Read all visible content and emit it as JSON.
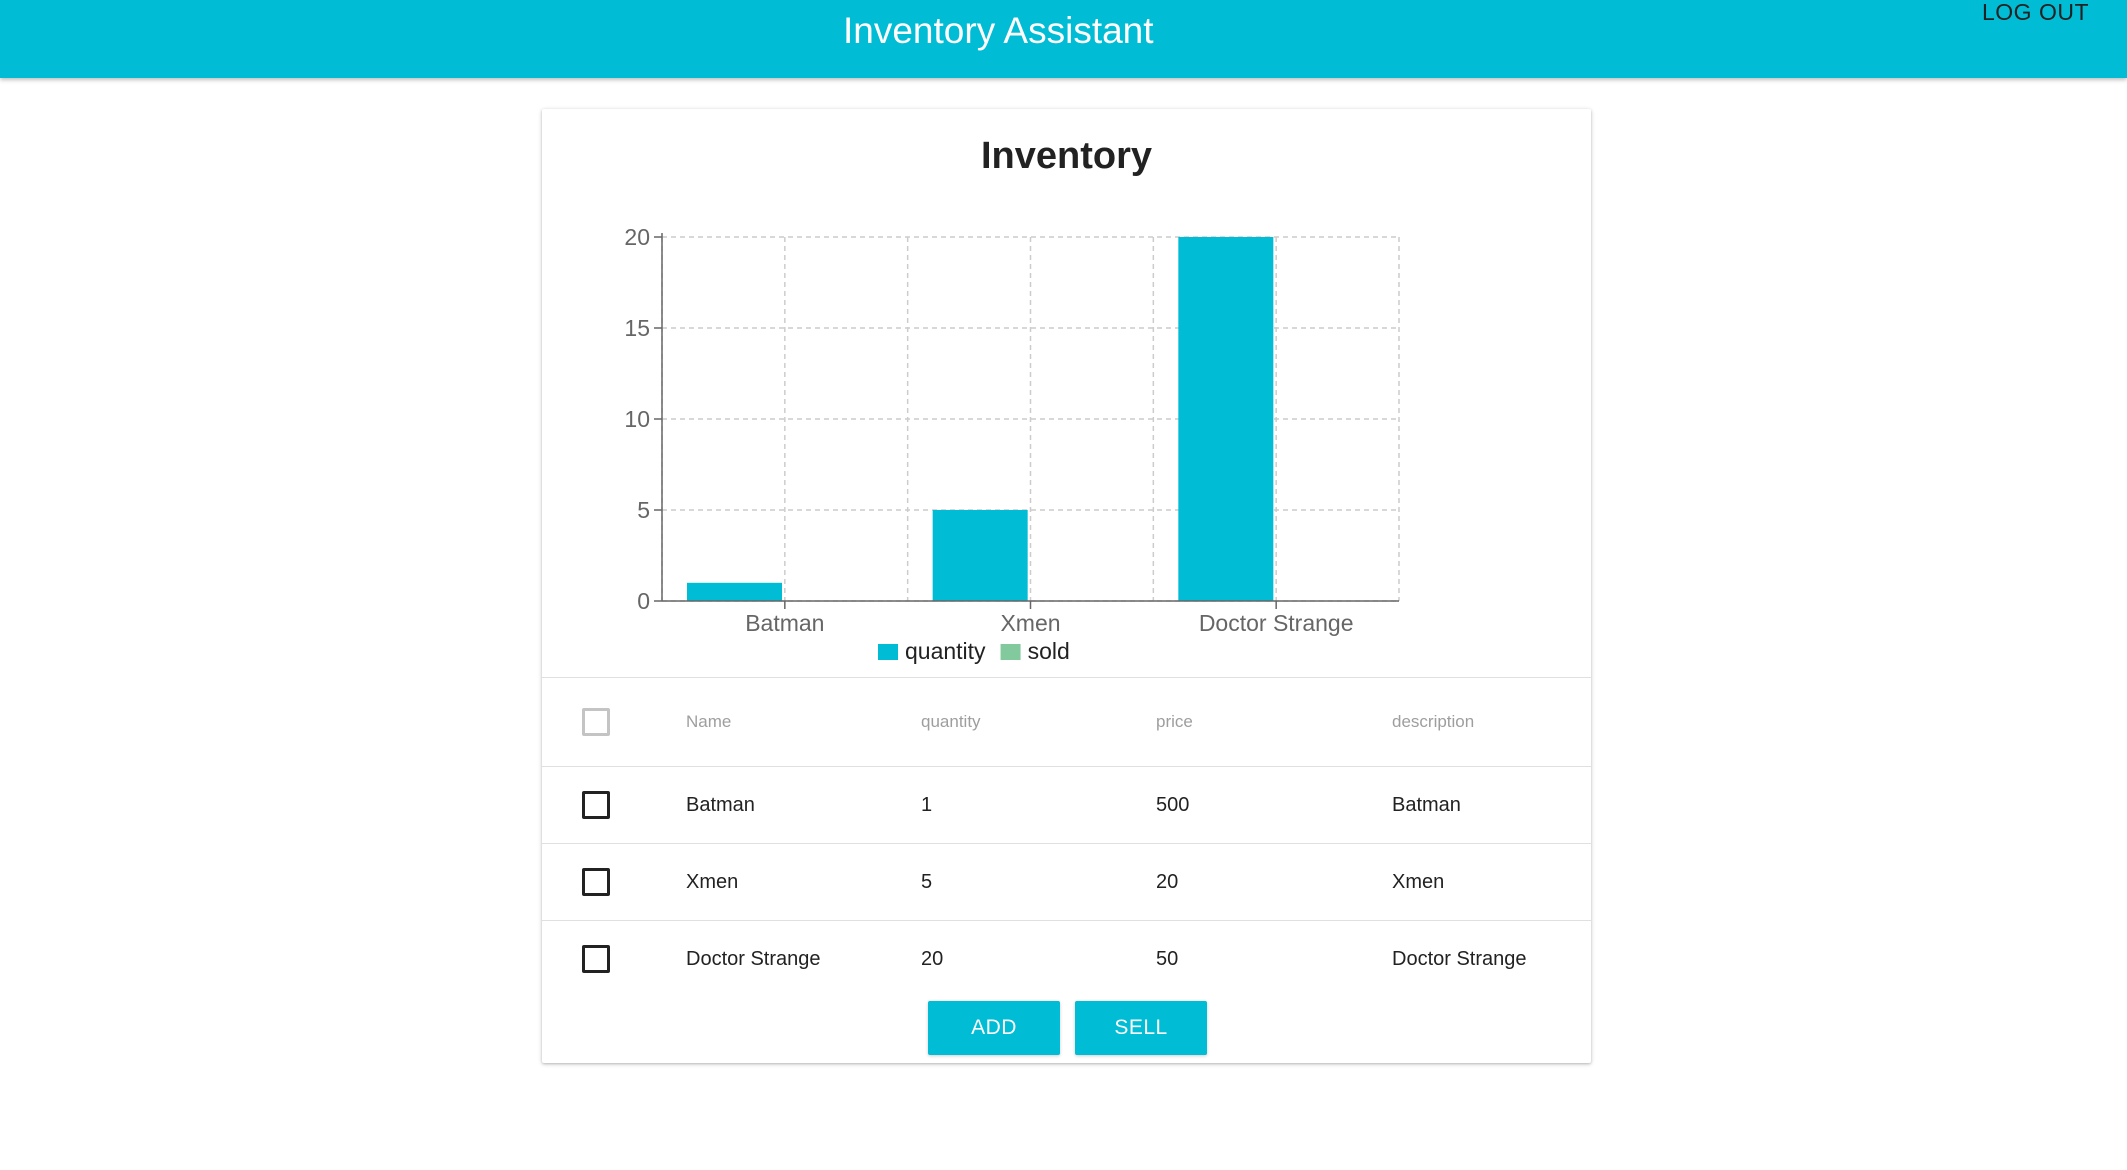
{
  "appbar": {
    "title": "Inventory Assistant",
    "logout_label": "LOG OUT"
  },
  "card": {
    "title": "Inventory"
  },
  "chart_data": {
    "type": "bar",
    "categories": [
      "Batman",
      "Xmen",
      "Doctor Strange"
    ],
    "series": [
      {
        "name": "quantity",
        "values": [
          1,
          5,
          20
        ],
        "color": "#00bcd4"
      },
      {
        "name": "sold",
        "values": [
          0,
          0,
          0
        ],
        "color": "#82ca9d"
      }
    ],
    "y_ticks": [
      "0",
      "5",
      "10",
      "15",
      "20"
    ],
    "ylim": [
      0,
      20
    ],
    "grid": true,
    "legend_position": "bottom-center"
  },
  "table": {
    "headers": [
      "Name",
      "quantity",
      "price",
      "description"
    ],
    "rows": [
      {
        "name": "Batman",
        "quantity": "1",
        "price": "500",
        "description": "Batman"
      },
      {
        "name": "Xmen",
        "quantity": "5",
        "price": "20",
        "description": "Xmen"
      },
      {
        "name": "Doctor Strange",
        "quantity": "20",
        "price": "50",
        "description": "Doctor Strange"
      }
    ]
  },
  "actions": {
    "add_label": "ADD",
    "sell_label": "SELL"
  },
  "colors": {
    "primary": "#00bcd4",
    "sold": "#82ca9d"
  }
}
